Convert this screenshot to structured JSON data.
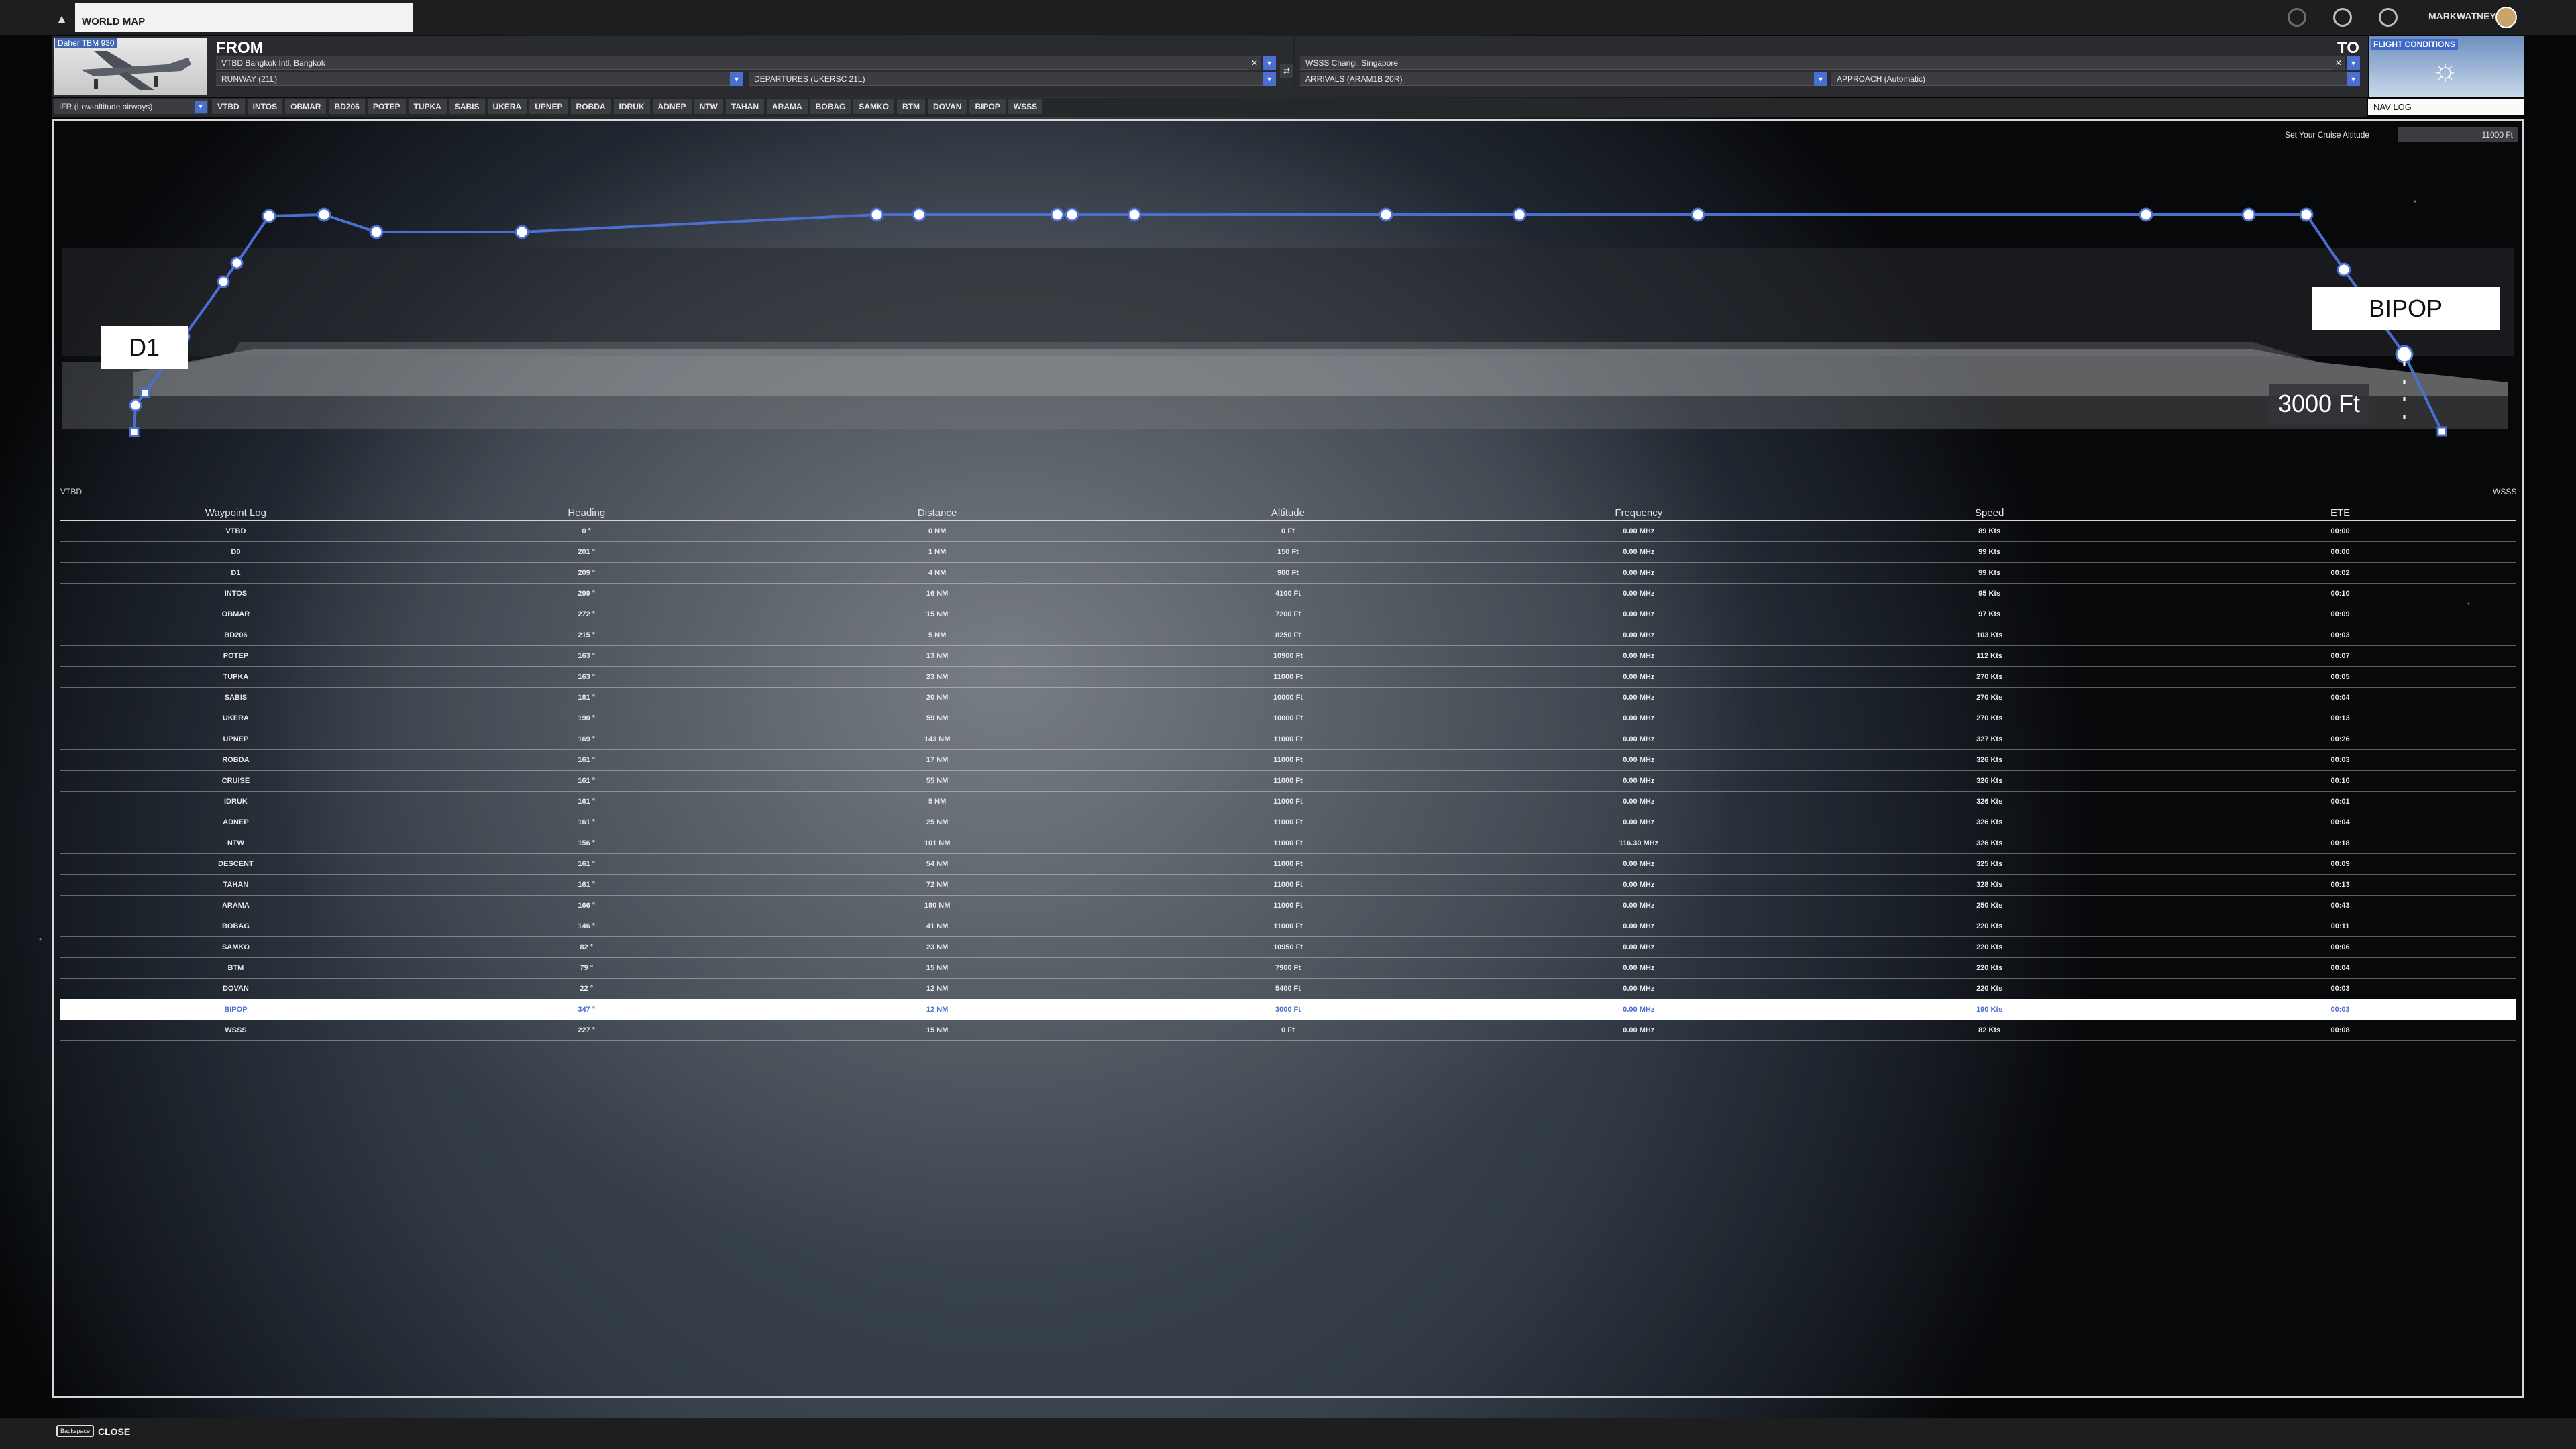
{
  "topbar": {
    "world_map_label": "WORLD MAP",
    "user_name": "MARKWATNEY"
  },
  "aircraft": {
    "label": "Daher TBM 930"
  },
  "from": {
    "title": "FROM",
    "airport": "VTBD Bangkok Intl, Bangkok",
    "runway": "RUNWAY (21L)",
    "departure": "DEPARTURES (UKERSC 21L)"
  },
  "to": {
    "title": "TO",
    "airport": "WSSS Changi, Singapore",
    "arrival": "ARRIVALS (ARAM1B 20R)",
    "approach": "APPROACH (Automatic)"
  },
  "flight_conditions": {
    "label": "FLIGHT CONDITIONS"
  },
  "nav_log_tab": "NAV LOG",
  "route_type": "IFR (Low-altitude airways)",
  "route_waypoints": [
    "VTBD",
    "INTOS",
    "OBMAR",
    "BD206",
    "POTEP",
    "TUPKA",
    "SABIS",
    "UKERA",
    "UPNEP",
    "ROBDA",
    "IDRUK",
    "ADNEP",
    "NTW",
    "TAHAN",
    "ARAMA",
    "BOBAG",
    "SAMKO",
    "BTM",
    "DOVAN",
    "BIPOP",
    "WSSS"
  ],
  "profile": {
    "cruise_label": "Set Your Cruise Altitude",
    "cruise_value": "11000 Ft",
    "left_callout": "D1",
    "right_callout": "BIPOP",
    "altitude_readout": "3000 Ft",
    "origin": "VTBD",
    "destination": "WSSS"
  },
  "table": {
    "headers": [
      "Waypoint Log",
      "Heading",
      "Distance",
      "Altitude",
      "Frequency",
      "Speed",
      "ETE"
    ],
    "rows": [
      [
        "VTBD",
        "0 °",
        "0 NM",
        "0 Ft",
        "0.00 MHz",
        "89 Kts",
        "00:00"
      ],
      [
        "D0",
        "201 °",
        "1 NM",
        "150 Ft",
        "0.00 MHz",
        "99 Kts",
        "00:00"
      ],
      [
        "D1",
        "209 °",
        "4 NM",
        "900 Ft",
        "0.00 MHz",
        "99 Kts",
        "00:02"
      ],
      [
        "INTOS",
        "299 °",
        "16 NM",
        "4100 Ft",
        "0.00 MHz",
        "95 Kts",
        "00:10"
      ],
      [
        "OBMAR",
        "272 °",
        "15 NM",
        "7200 Ft",
        "0.00 MHz",
        "97 Kts",
        "00:09"
      ],
      [
        "BD206",
        "215 °",
        "5 NM",
        "8250 Ft",
        "0.00 MHz",
        "103 Kts",
        "00:03"
      ],
      [
        "POTEP",
        "163 °",
        "13 NM",
        "10900 Ft",
        "0.00 MHz",
        "112 Kts",
        "00:07"
      ],
      [
        "TUPKA",
        "163 °",
        "23 NM",
        "11000 Ft",
        "0.00 MHz",
        "270 Kts",
        "00:05"
      ],
      [
        "SABIS",
        "181 °",
        "20 NM",
        "10000 Ft",
        "0.00 MHz",
        "270 Kts",
        "00:04"
      ],
      [
        "UKERA",
        "190 °",
        "59 NM",
        "10000 Ft",
        "0.00 MHz",
        "270 Kts",
        "00:13"
      ],
      [
        "UPNEP",
        "169 °",
        "143 NM",
        "11000 Ft",
        "0.00 MHz",
        "327 Kts",
        "00:26"
      ],
      [
        "ROBDA",
        "161 °",
        "17 NM",
        "11000 Ft",
        "0.00 MHz",
        "326 Kts",
        "00:03"
      ],
      [
        "CRUISE",
        "161 °",
        "55 NM",
        "11000 Ft",
        "0.00 MHz",
        "326 Kts",
        "00:10"
      ],
      [
        "IDRUK",
        "161 °",
        "5 NM",
        "11000 Ft",
        "0.00 MHz",
        "326 Kts",
        "00:01"
      ],
      [
        "ADNEP",
        "161 °",
        "25 NM",
        "11000 Ft",
        "0.00 MHz",
        "326 Kts",
        "00:04"
      ],
      [
        "NTW",
        "156 °",
        "101 NM",
        "11000 Ft",
        "116.30 MHz",
        "326 Kts",
        "00:18"
      ],
      [
        "DESCENT",
        "161 °",
        "54 NM",
        "11000 Ft",
        "0.00 MHz",
        "325 Kts",
        "00:09"
      ],
      [
        "TAHAN",
        "161 °",
        "72 NM",
        "11000 Ft",
        "0.00 MHz",
        "328 Kts",
        "00:13"
      ],
      [
        "ARAMA",
        "166 °",
        "180 NM",
        "11000 Ft",
        "0.00 MHz",
        "250 Kts",
        "00:43"
      ],
      [
        "BOBAG",
        "146 °",
        "41 NM",
        "11000 Ft",
        "0.00 MHz",
        "220 Kts",
        "00:11"
      ],
      [
        "SAMKO",
        "82 °",
        "23 NM",
        "10950 Ft",
        "0.00 MHz",
        "220 Kts",
        "00:06"
      ],
      [
        "BTM",
        "79 °",
        "15 NM",
        "7900 Ft",
        "0.00 MHz",
        "220 Kts",
        "00:04"
      ],
      [
        "DOVAN",
        "22 °",
        "12 NM",
        "5400 Ft",
        "0.00 MHz",
        "220 Kts",
        "00:03"
      ],
      [
        "BIPOP",
        "347 °",
        "12 NM",
        "3000 Ft",
        "0.00 MHz",
        "190 Kts",
        "00:03"
      ],
      [
        "WSSS",
        "227 °",
        "15 NM",
        "0 Ft",
        "0.00 MHz",
        "82 Kts",
        "00:08"
      ]
    ],
    "selected_row": 23
  },
  "bottom": {
    "key": "Backspace",
    "close_label": "CLOSE"
  },
  "colors": {
    "accent": "#4b6fd0",
    "panel": "#2a2b2e"
  }
}
